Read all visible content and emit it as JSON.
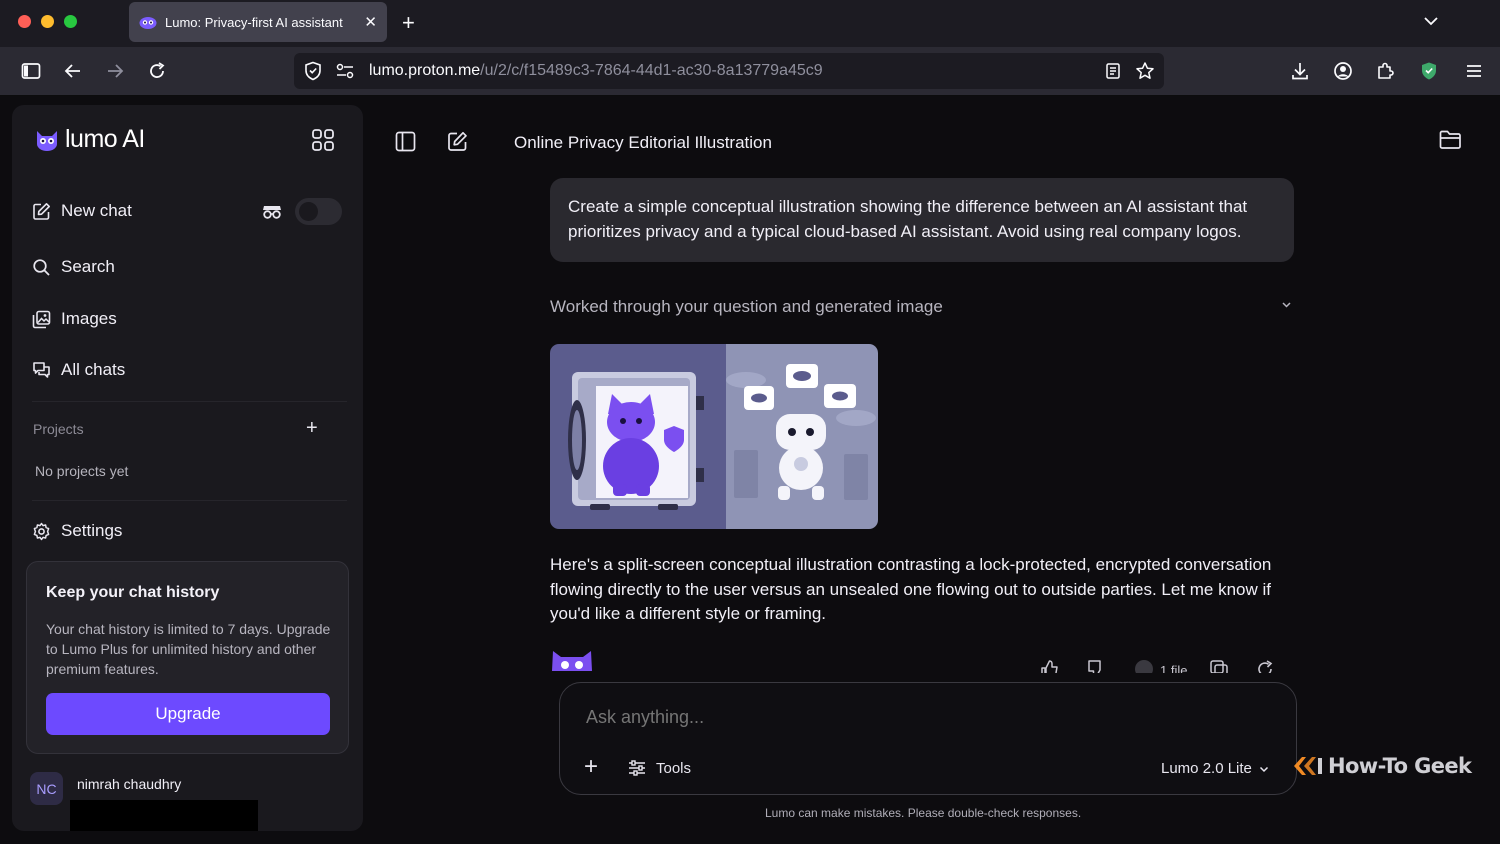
{
  "browser": {
    "tab_title": "Lumo: Privacy-first AI assistant",
    "tab_close": "✕",
    "new_tab": "+",
    "url_host": "lumo.proton.me",
    "url_path": "/u/2/c/f15489c3-7864-44d1-ac30-8a13779a45c9",
    "traffic_colors": [
      "#ff5f57",
      "#febc2e",
      "#28c840"
    ]
  },
  "sidebar": {
    "brand": "lumo AI",
    "nav": {
      "new_chat": "New chat",
      "search": "Search",
      "images": "Images",
      "all_chats": "All chats",
      "settings": "Settings"
    },
    "ghost_mode_on": false,
    "projects_label": "Projects",
    "projects_add": "+",
    "no_projects": "No projects yet",
    "upgrade": {
      "title": "Keep your chat history",
      "description": "Your chat history is limited to 7 days. Upgrade to Lumo Plus for unlimited history and other premium features.",
      "button": "Upgrade"
    },
    "user": {
      "initials": "NC",
      "name": "nimrah chaudhry"
    }
  },
  "main": {
    "chat_title": "Online Privacy Editorial Illustration",
    "user_message": "Create a simple conceptual illustration showing the difference between an AI assistant that prioritizes privacy and a typical cloud-based AI assistant. Avoid using real company logos.",
    "reasoning_summary": "Worked through your question and generated image",
    "assistant_message": "Here's a split-screen conceptual illustration contrasting a lock-protected, encrypted conversation flowing directly to the user versus an unsealed one flowing out to outside parties. Let me know if you'd like a different style or framing.",
    "files_label": "1 file"
  },
  "composer": {
    "placeholder": "Ask anything...",
    "plus": "+",
    "tools_label": "Tools",
    "model_label": "Lumo 2.0 Lite",
    "disclaimer": "Lumo can make mistakes. Please double-check responses."
  },
  "watermark": "How-To Geek",
  "colors": {
    "accent": "#6d4aff",
    "background": "#0d0c0f",
    "sidebar": "#1a191e"
  }
}
